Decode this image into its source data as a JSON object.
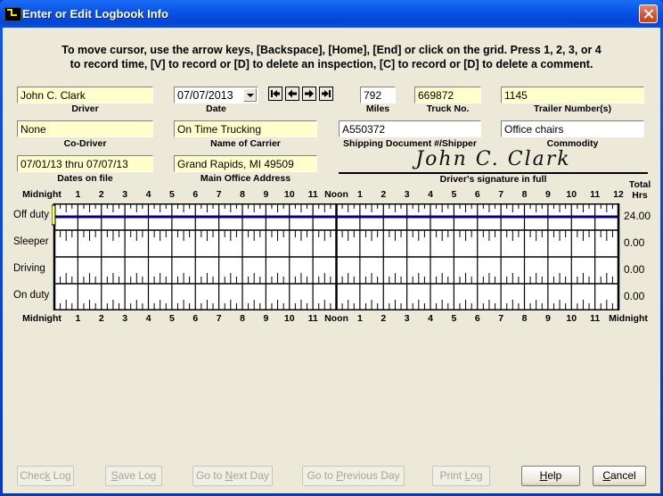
{
  "window": {
    "title": "Enter or Edit Logbook Info",
    "close_label": "Close"
  },
  "instructions": {
    "line1": "To move cursor, use the arrow keys, [Backspace], [Home], [End] or click on the grid.  Press 1, 2, 3, or 4",
    "line2": "to record time, [V] to record or [D] to delete an inspection, [C] to record or [D] to delete a comment."
  },
  "fields": {
    "driver": {
      "value": "John C. Clark",
      "label": "Driver"
    },
    "date": {
      "value": "07/07/2013",
      "label": "Date"
    },
    "miles": {
      "value": "792",
      "label": "Miles"
    },
    "truck_no": {
      "value": "669872",
      "label": "Truck No."
    },
    "trailer": {
      "value": "1145",
      "label": "Trailer Number(s)"
    },
    "co_driver": {
      "value": "None",
      "label": "Co-Driver"
    },
    "carrier": {
      "value": "On Time Trucking",
      "label": "Name of Carrier"
    },
    "shipping_doc": {
      "value": "A550372",
      "label": "Shipping Document #/Shipper"
    },
    "commodity": {
      "value": "Office chairs",
      "label": "Commodity"
    },
    "dates_on_file": {
      "value": "07/01/13 thru 07/07/13",
      "label": "Dates on file"
    },
    "office_address": {
      "value": "Grand Rapids, MI  49509",
      "label": "Main Office Address"
    }
  },
  "nav_buttons": [
    {
      "name": "first-day",
      "icon": "first-icon"
    },
    {
      "name": "previous-day",
      "icon": "arrow-left-icon"
    },
    {
      "name": "next-day",
      "icon": "arrow-right-icon"
    },
    {
      "name": "last-day",
      "icon": "last-icon"
    }
  ],
  "signature": {
    "value": "John C. Clark",
    "label": "Driver's signature in full"
  },
  "grid": {
    "hour_labels": [
      "Midnight",
      "1",
      "2",
      "3",
      "4",
      "5",
      "6",
      "7",
      "8",
      "9",
      "10",
      "11",
      "Noon",
      "1",
      "2",
      "3",
      "4",
      "5",
      "6",
      "7",
      "8",
      "9",
      "10",
      "11"
    ],
    "top_end_label": "12",
    "bottom_end_label": "Midnight",
    "total_header": "Total\nHrs",
    "rows": [
      {
        "status": "Off duty",
        "total": "24.00",
        "duty_from_hour": 0,
        "duty_to_hour": 24
      },
      {
        "status": "Sleeper",
        "total": "0.00"
      },
      {
        "status": "Driving",
        "total": "0.00"
      },
      {
        "status": "On duty",
        "total": "0.00"
      }
    ],
    "cursor_hour": 0,
    "line_color": "#000080",
    "cursor_color": "#ffff66"
  },
  "buttons": [
    {
      "name": "check-log-button",
      "pre": "Chec",
      "key": "k",
      "post": " Log",
      "enabled": false
    },
    {
      "name": "save-log-button",
      "pre": "",
      "key": "S",
      "post": "ave Log",
      "enabled": false
    },
    {
      "name": "go-to-next-day-button",
      "pre": "Go to ",
      "key": "N",
      "post": "ext Day",
      "enabled": false
    },
    {
      "name": "go-to-previous-day-button",
      "pre": "Go to ",
      "key": "P",
      "post": "revious Day",
      "enabled": false
    },
    {
      "name": "print-log-button",
      "pre": "Print ",
      "key": "L",
      "post": "og",
      "enabled": false
    },
    {
      "name": "help-button",
      "pre": "",
      "key": "H",
      "post": "elp",
      "enabled": true
    },
    {
      "name": "cancel-button",
      "pre": "",
      "key": "C",
      "post": "ancel",
      "enabled": true
    }
  ]
}
